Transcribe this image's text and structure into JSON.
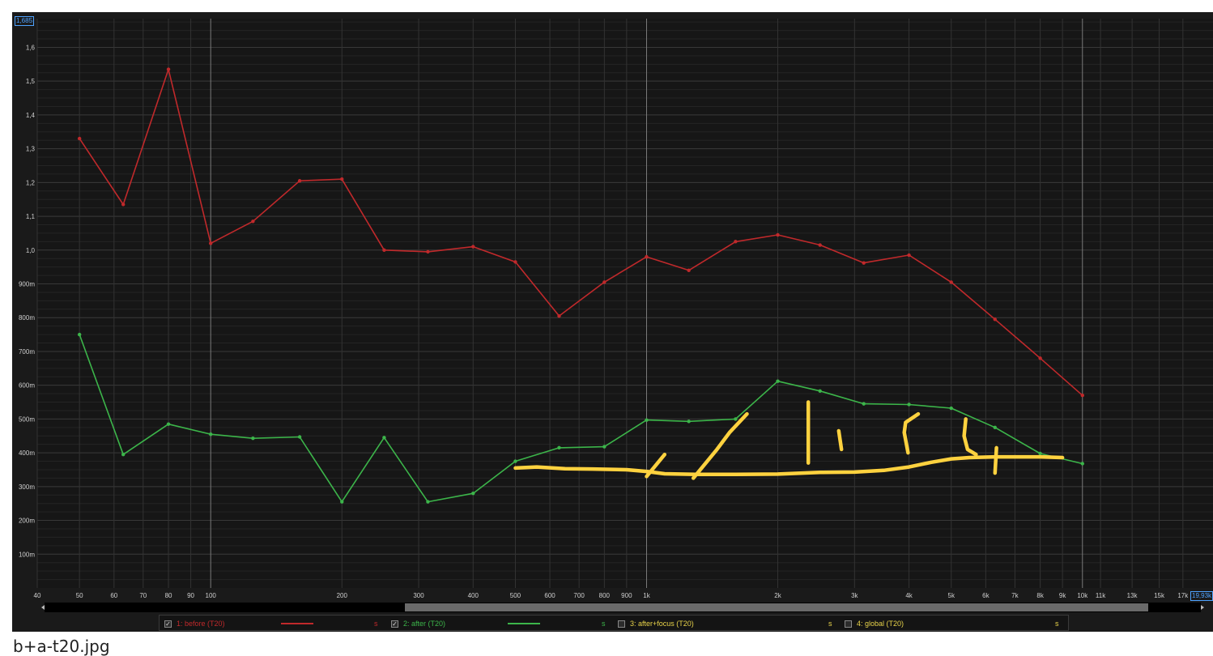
{
  "caption": "b+a-t20.jpg",
  "cursor_readouts": {
    "y_max": "1,685",
    "x_max": "19,93k"
  },
  "legend": [
    {
      "checked": true,
      "label": "1: before (T20)",
      "unit": "s",
      "color": "#c0292b"
    },
    {
      "checked": true,
      "label": "2: after (T20)",
      "unit": "s",
      "color": "#3cb54a"
    },
    {
      "checked": false,
      "label": "3: after+focus (T20)",
      "unit": "s",
      "color": "#e8d34a"
    },
    {
      "checked": false,
      "label": "4: global (T20)",
      "unit": "s",
      "color": "#e8d34a"
    }
  ],
  "colors": {
    "background": "#1a1a1a",
    "grid": "#3a3a3a",
    "tick_text": "#cfcfcf",
    "annotation": "#ffd23f"
  },
  "chart_data": {
    "type": "line",
    "xscale": "log",
    "xlim": [
      40,
      19930
    ],
    "ylim": [
      0,
      1.685
    ],
    "grid": true,
    "x_tick_labels": [
      {
        "v": 40,
        "t": "40"
      },
      {
        "v": 50,
        "t": "50"
      },
      {
        "v": 60,
        "t": "60"
      },
      {
        "v": 70,
        "t": "70"
      },
      {
        "v": 80,
        "t": "80"
      },
      {
        "v": 90,
        "t": "90"
      },
      {
        "v": 100,
        "t": "100"
      },
      {
        "v": 200,
        "t": "200"
      },
      {
        "v": 300,
        "t": "300"
      },
      {
        "v": 400,
        "t": "400"
      },
      {
        "v": 500,
        "t": "500"
      },
      {
        "v": 600,
        "t": "600"
      },
      {
        "v": 700,
        "t": "700"
      },
      {
        "v": 800,
        "t": "800"
      },
      {
        "v": 900,
        "t": "900"
      },
      {
        "v": 1000,
        "t": "1k"
      },
      {
        "v": 2000,
        "t": "2k"
      },
      {
        "v": 3000,
        "t": "3k"
      },
      {
        "v": 4000,
        "t": "4k"
      },
      {
        "v": 5000,
        "t": "5k"
      },
      {
        "v": 6000,
        "t": "6k"
      },
      {
        "v": 7000,
        "t": "7k"
      },
      {
        "v": 8000,
        "t": "8k"
      },
      {
        "v": 9000,
        "t": "9k"
      },
      {
        "v": 10000,
        "t": "10k"
      },
      {
        "v": 11000,
        "t": "11k"
      },
      {
        "v": 13000,
        "t": "13k"
      },
      {
        "v": 15000,
        "t": "15k"
      },
      {
        "v": 17000,
        "t": "17k"
      }
    ],
    "y_tick_labels": [
      {
        "v": 0.1,
        "t": "100m"
      },
      {
        "v": 0.2,
        "t": "200m"
      },
      {
        "v": 0.3,
        "t": "300m"
      },
      {
        "v": 0.4,
        "t": "400m"
      },
      {
        "v": 0.5,
        "t": "500m"
      },
      {
        "v": 0.6,
        "t": "600m"
      },
      {
        "v": 0.7,
        "t": "700m"
      },
      {
        "v": 0.8,
        "t": "800m"
      },
      {
        "v": 0.9,
        "t": "900m"
      },
      {
        "v": 1.0,
        "t": "1,0"
      },
      {
        "v": 1.1,
        "t": "1,1"
      },
      {
        "v": 1.2,
        "t": "1,2"
      },
      {
        "v": 1.3,
        "t": "1,3"
      },
      {
        "v": 1.4,
        "t": "1,4"
      },
      {
        "v": 1.5,
        "t": "1,5"
      },
      {
        "v": 1.6,
        "t": "1,6"
      }
    ],
    "x": [
      50,
      63,
      80,
      100,
      125,
      160,
      200,
      250,
      315,
      400,
      500,
      630,
      800,
      1000,
      1250,
      1600,
      2000,
      2500,
      3150,
      4000,
      5000,
      6300,
      8000,
      10000
    ],
    "series": [
      {
        "name": "1: before (T20)",
        "color": "#c0292b",
        "values": [
          1.33,
          1.135,
          1.535,
          1.02,
          1.085,
          1.205,
          1.21,
          1.0,
          0.995,
          1.01,
          0.965,
          0.805,
          0.905,
          0.98,
          0.94,
          1.025,
          1.045,
          1.015,
          0.962,
          0.985,
          0.905,
          0.795,
          0.68,
          0.57
        ]
      },
      {
        "name": "2: after (T20)",
        "color": "#3cb54a",
        "values": [
          0.75,
          0.395,
          0.485,
          0.455,
          0.443,
          0.447,
          0.255,
          0.445,
          0.255,
          0.28,
          0.375,
          0.415,
          0.418,
          0.497,
          0.493,
          0.5,
          0.612,
          0.583,
          0.545,
          0.543,
          0.532,
          0.475,
          0.398,
          0.368
        ]
      }
    ],
    "annotation_curve": {
      "x": [
        500,
        560,
        650,
        750,
        900,
        1000,
        1100,
        1300,
        1600,
        2000,
        2500,
        3000,
        3500,
        4000,
        4500,
        5000,
        5500,
        6300,
        7000,
        8000,
        9000
      ],
      "values": [
        0.355,
        0.358,
        0.353,
        0.352,
        0.35,
        0.345,
        0.338,
        0.336,
        0.336,
        0.337,
        0.342,
        0.343,
        0.348,
        0.358,
        0.372,
        0.382,
        0.386,
        0.388,
        0.388,
        0.388,
        0.386
      ]
    },
    "annotation_marks": [
      {
        "x": [
          1000,
          1100
        ],
        "values": [
          0.33,
          0.395
        ]
      },
      {
        "x": [
          1280,
          1450,
          1550,
          1700
        ],
        "values": [
          0.325,
          0.41,
          0.46,
          0.515
        ]
      },
      {
        "x": [
          2350,
          2350
        ],
        "values": [
          0.37,
          0.55
        ]
      },
      {
        "x": [
          2800,
          2760
        ],
        "values": [
          0.41,
          0.465
        ]
      },
      {
        "x": [
          3980,
          3900,
          3930,
          4200
        ],
        "values": [
          0.4,
          0.46,
          0.49,
          0.515
        ]
      },
      {
        "x": [
          5400,
          5350,
          5450,
          5700
        ],
        "values": [
          0.5,
          0.45,
          0.41,
          0.395
        ]
      },
      {
        "x": [
          6300,
          6350
        ],
        "values": [
          0.34,
          0.415
        ]
      }
    ]
  }
}
